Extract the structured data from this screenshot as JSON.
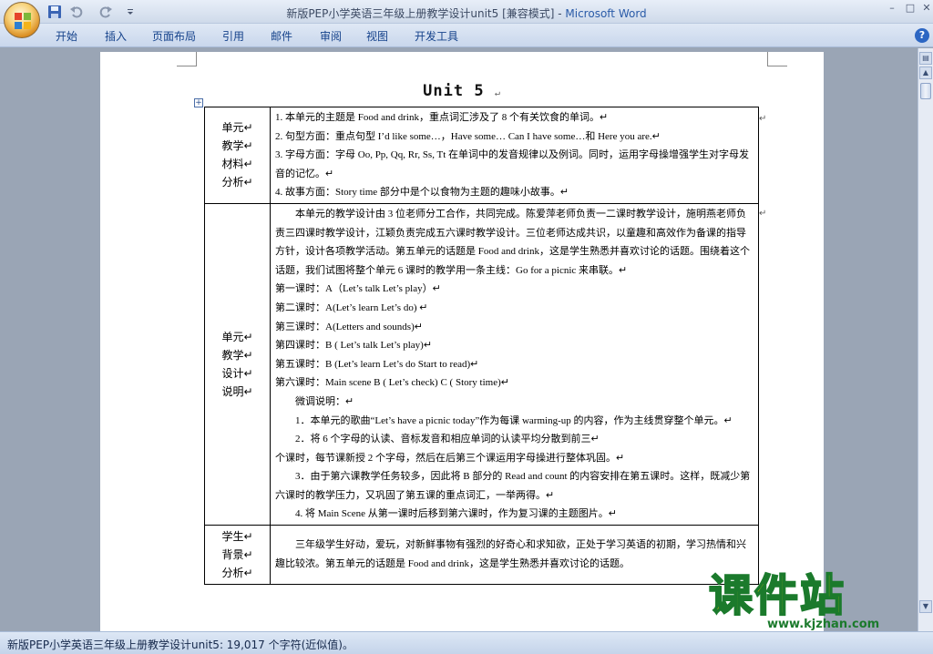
{
  "window": {
    "title": "新版PEP小学英语三年级上册教学设计unit5 [兼容模式] - ",
    "app_name": "Microsoft Word",
    "minimize": "–",
    "maximize": "□",
    "close": "✕"
  },
  "ribbon": {
    "tabs": [
      "开始",
      "插入",
      "页面布局",
      "引用",
      "邮件",
      "审阅",
      "视图",
      "开发工具"
    ],
    "help": "?"
  },
  "document": {
    "heading": "Unit  5",
    "para_mark": "↵",
    "table_handle": "+",
    "rows": [
      {
        "label": [
          "单元↵",
          "教学↵",
          "材料↵",
          "分析↵"
        ],
        "lines": [
          "1. 本单元的主题是 Food and drink，重点词汇涉及了 8 个有关饮食的单词。↵",
          "2. 句型方面：重点句型 I’d like some…，Have some… Can I have some…和 Here you are.↵",
          "3. 字母方面：字母 Oo, Pp, Qq, Rr, Ss, Tt 在单词中的发音规律以及例词。同时，运用字母操增强学生对字母发音的记忆。↵",
          "4. 故事方面：Story time  部分中是个以食物为主题的趣味小故事。↵"
        ]
      },
      {
        "label": [
          "单元↵",
          "教学↵",
          "设计↵",
          "说明↵"
        ],
        "lines": [
          "本单元的教学设计由  3  位老师分工合作，共同完成。陈爱萍老师负责一二课时教学设计，施明燕老师负责三四课时教学设计，江颖负责完成五六课时教学设计。三位老师达成共识，以童趣和高效作为备课的指导方针，设计各项教学活动。第五单元的话题是 Food and drink，这是学生熟悉并喜欢讨论的话题。围绕着这个话题，我们试图将整个单元 6 课时的教学用一条主线：Go for a picnic 来串联。↵",
          "第一课时：A（Let’s talk      Let’s play）↵",
          "第二课时：A(Let’s learn      Let’s do)       ↵",
          "第三课时：A(Letters and sounds)↵",
          "第四课时：B ( Let’s talk        Let’s play)↵",
          "第五课时：B (Let’s learn      Let’s do     Start     to read)↵",
          "第六课时：Main scene B ( Let’s check)     C ( Story time)↵",
          "微调说明：↵",
          "1．本单元的歌曲“Let’s have a picnic today”作为每课 warming-up 的内容，作为主线贯穿整个单元。↵",
          "2．将 6 个字母的认读、音标发音和相应单词的认读平均分散到前三↵",
          "个课时，每节课新授 2 个字母，然后在后第三个课运用字母操进行整体巩固。↵",
          "3．由于第六课教学任务较多，因此将 B 部分的 Read and count 的内容安排在第五课时。这样，既减少第六课时的教学压力，又巩固了第五课的重点词汇，一举两得。↵",
          "4. 将 Main Scene 从第一课时后移到第六课时，作为复习课的主题图片。↵"
        ]
      },
      {
        "label": [
          "学生↵",
          "背景↵",
          "分析↵"
        ],
        "lines": [
          "三年级学生好动，爱玩，对新鲜事物有强烈的好奇心和求知欲，正处于学习英语的初期，学习热情和兴趣比较浓。第五单元的话题是 Food and drink，这是学生熟悉并喜欢讨论的话题。"
        ]
      }
    ]
  },
  "statusbar": {
    "text": "新版PEP小学英语三年级上册教学设计unit5: 19,017 个字符(近似值)。"
  },
  "watermark": {
    "main": "课件站",
    "url": "www.kjzhan.com"
  }
}
